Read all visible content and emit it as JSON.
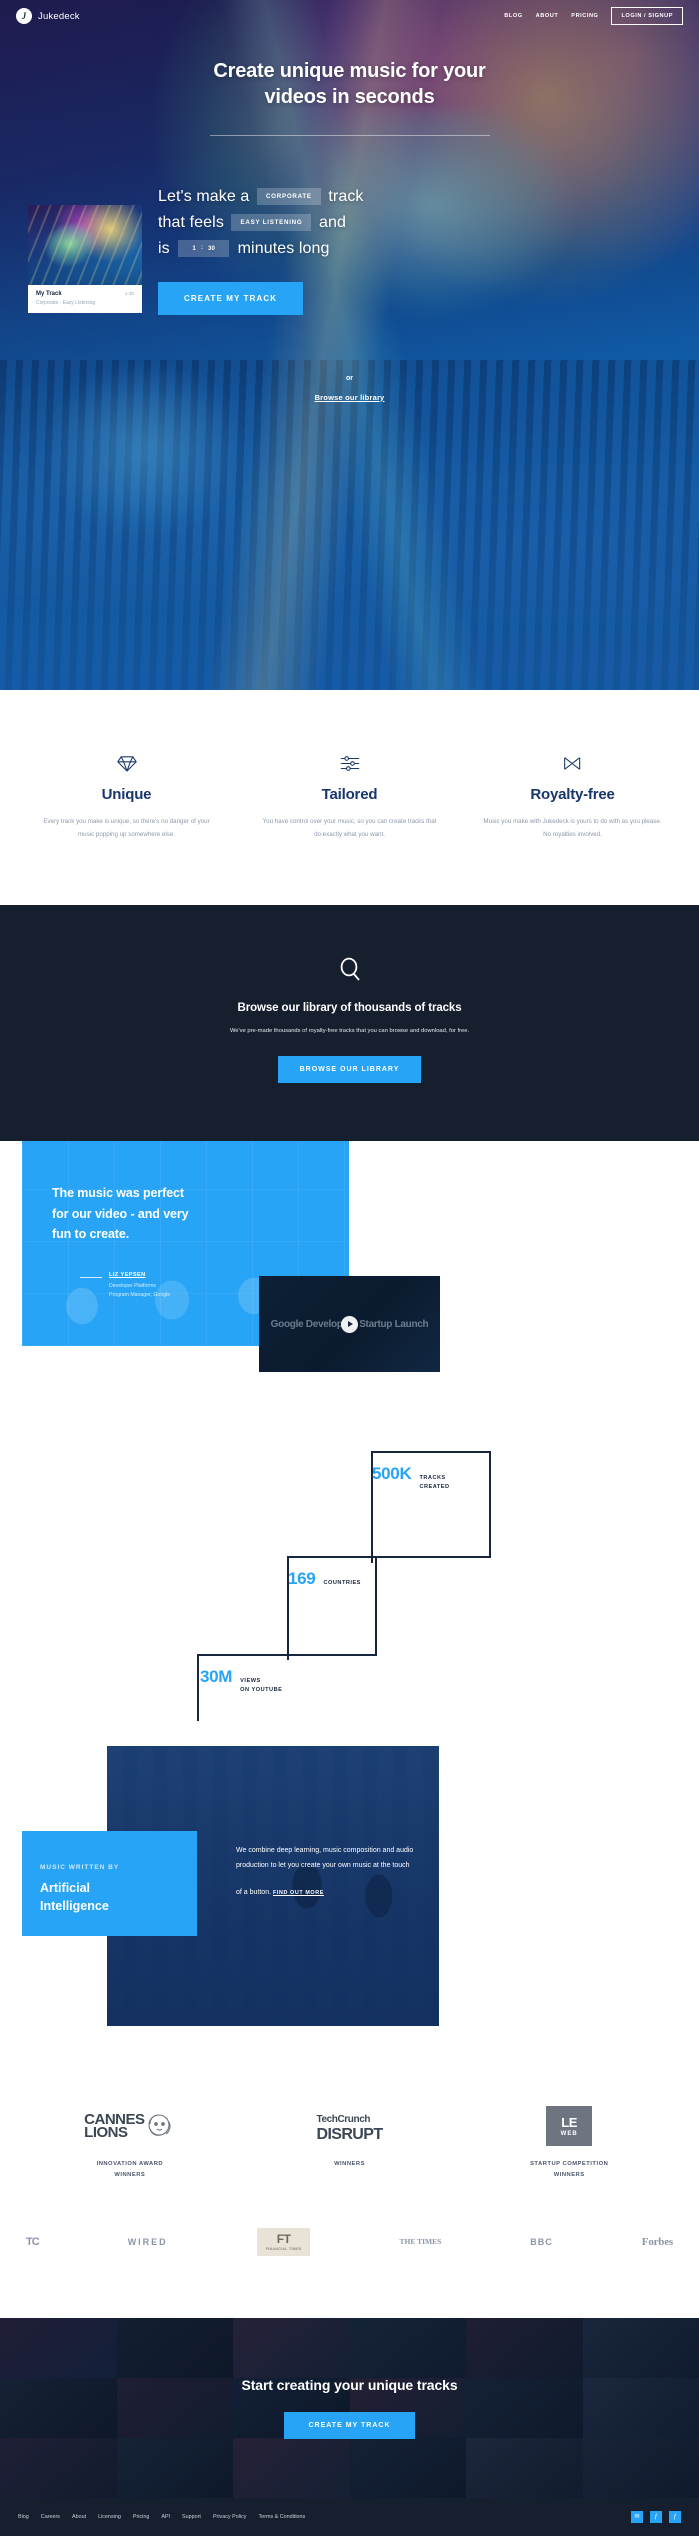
{
  "nav": {
    "brand": "Jukedeck",
    "brand_mark": "J",
    "links": [
      "BLOG",
      "ABOUT",
      "PRICING"
    ],
    "cta": "LOGIN / SIGNUP"
  },
  "hero": {
    "title_line1": "Create unique music for your",
    "title_line2": "videos in seconds",
    "builder": {
      "part1": "Let's make a",
      "genre": "CORPORATE",
      "part2": "track",
      "part3": "that feels",
      "mood": "EASY LISTENING",
      "part4": "and",
      "part5": "is",
      "minutes": "1",
      "colon": ":",
      "seconds": "30",
      "part6": "minutes long",
      "cta": "CREATE MY TRACK"
    },
    "track_card": {
      "name": "My Track",
      "duration": "1:30",
      "subtitle": "Corporate - Easy Listening"
    },
    "or": "or",
    "browse_link": "Browse our library"
  },
  "features": [
    {
      "icon": "diamond-icon",
      "title": "Unique",
      "desc": "Every track you make is unique, so there's no danger of your music popping up somewhere else."
    },
    {
      "icon": "sliders-icon",
      "title": "Tailored",
      "desc": "You have control over your music, so you can create tracks that do exactly what you want."
    },
    {
      "icon": "royalty-free-icon",
      "title": "Royalty-free",
      "desc": "Music you make with Jukedeck is yours to do with as you please. No royalties involved."
    }
  ],
  "library": {
    "icon": "search-icon",
    "title": "Browse our library of thousands of tracks",
    "subtitle": "We've pre-made thousands of royalty-free tracks that you can browse and download, for free.",
    "cta": "BROWSE OUR LIBRARY"
  },
  "testimonial": {
    "quote_l1": "The music was perfect",
    "quote_l2": "for our video - and very",
    "quote_l3": "fun to create.",
    "author": "LIZ YEPSEN",
    "role_l1": "Developer Platforms",
    "role_l2": "Program Manager, Google",
    "video_logo": "Google Developers Startup Launch",
    "play": "play-button"
  },
  "stats": [
    {
      "value": "500K",
      "label_l1": "TRACKS",
      "label_l2": "CREATED"
    },
    {
      "value": "169",
      "label_l1": "COUNTRIES",
      "label_l2": ""
    },
    {
      "value": "30M",
      "label_l1": "VIEWS",
      "label_l2": "ON YOUTUBE"
    }
  ],
  "ai": {
    "kicker": "MUSIC WRITTEN BY",
    "head_l1": "Artificial",
    "head_l2": "Intelligence",
    "copy": "We combine deep learning, music composition and audio production to let you create your own music at the touch of a button.",
    "link": "FIND OUT MORE"
  },
  "awards": [
    {
      "logo_l1": "CANNES",
      "logo_l2": "LIONS",
      "cap_l1": "INNOVATION AWARD",
      "cap_l2": "WINNERS"
    },
    {
      "logo_l1": "TechCrunch",
      "logo_l2": "DISRUPT",
      "cap_l1": "WINNERS",
      "cap_l2": ""
    },
    {
      "logo_l1": "LE",
      "logo_l2": "WEB",
      "cap_l1": "STARTUP COMPETITION",
      "cap_l2": "WINNERS"
    }
  ],
  "press": [
    {
      "name": "TC"
    },
    {
      "name": "WIRED"
    },
    {
      "name": "FT",
      "sub": "FINANCIAL TIMES"
    },
    {
      "name": "THE TIMES"
    },
    {
      "name": "BBC"
    },
    {
      "name": "Forbes"
    }
  ],
  "cta_footer": {
    "title": "Start creating your unique tracks",
    "button": "CREATE MY TRACK"
  },
  "footer": {
    "links": [
      "Blog",
      "Careers",
      "About",
      "Licensing",
      "Pricing",
      "API",
      "Support",
      "Privacy Policy",
      "Terms & Conditions"
    ],
    "social": [
      "✉",
      "ƒ",
      "ƒ"
    ]
  },
  "colors": {
    "accent": "#27a4f5",
    "dark": "#161f2e",
    "navy": "#17263c"
  }
}
